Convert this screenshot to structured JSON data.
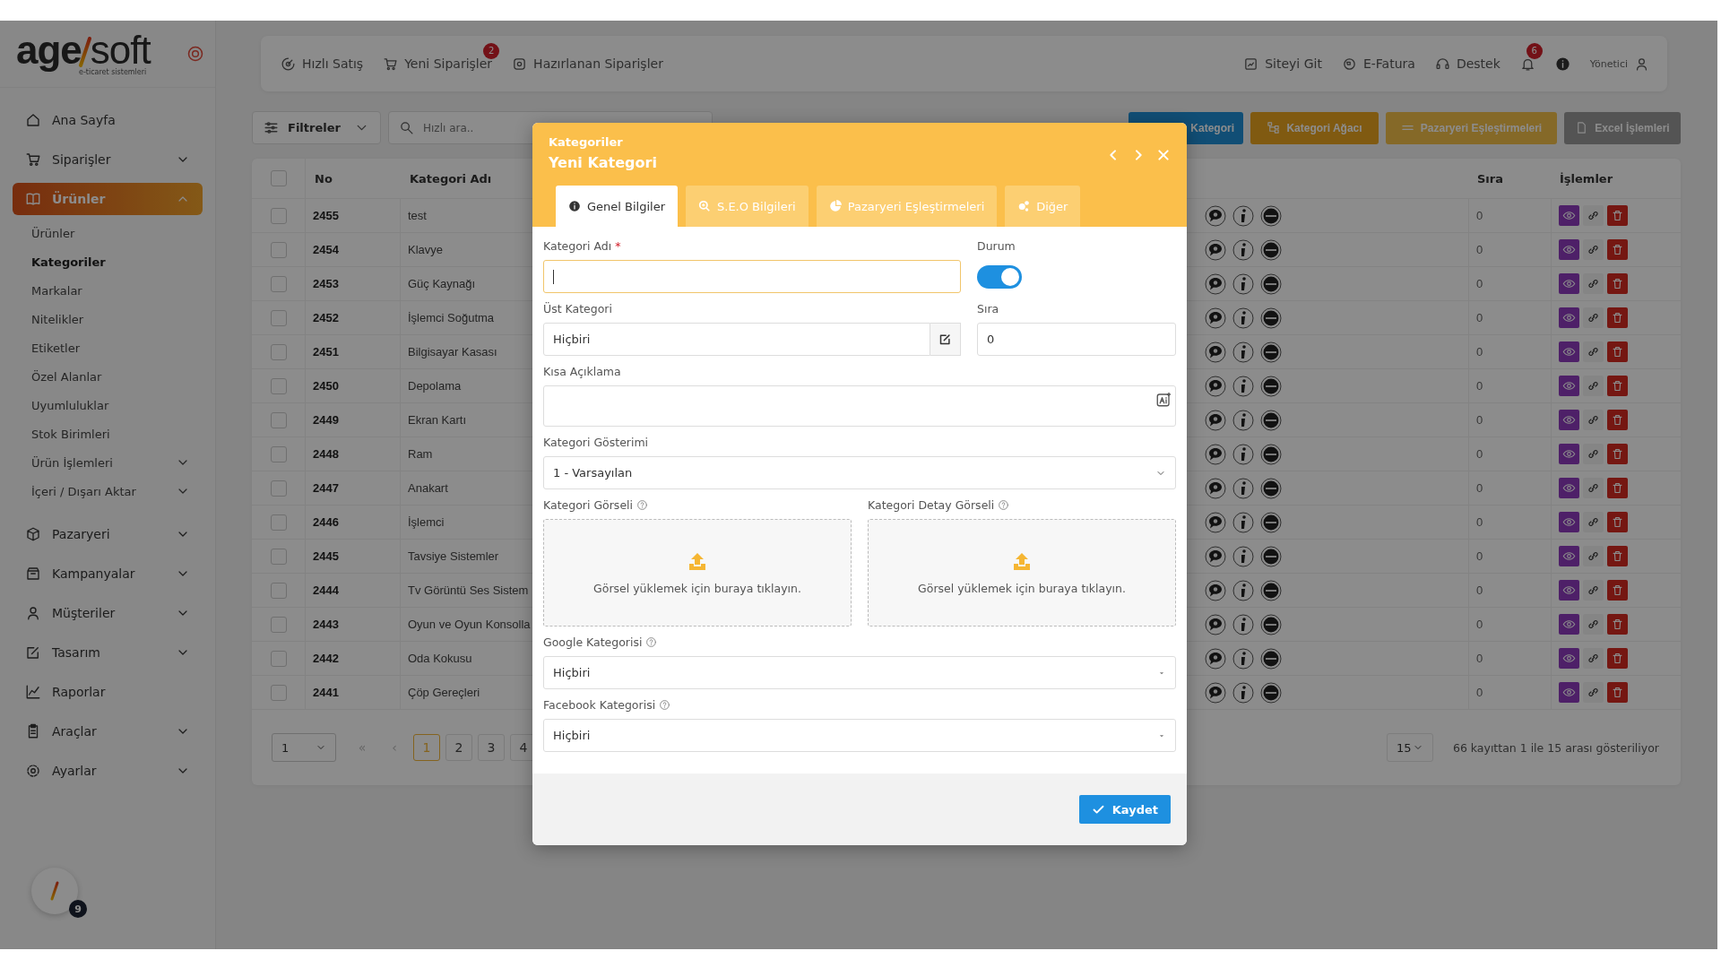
{
  "logo": {
    "bold": "age",
    "light": "soft",
    "tagline": "e-ticaret sistemleri"
  },
  "sidebar": {
    "items": [
      {
        "label": "Ana Sayfa",
        "expandable": false,
        "selected": false
      },
      {
        "label": "Siparişler",
        "expandable": true,
        "expanded": false,
        "selected": false
      },
      {
        "label": "Ürünler",
        "expandable": true,
        "expanded": true,
        "selected": true,
        "children": [
          {
            "label": "Ürünler",
            "selected": false,
            "expandable": false
          },
          {
            "label": "Kategoriler",
            "selected": true,
            "expandable": false
          },
          {
            "label": "Markalar",
            "selected": false,
            "expandable": false
          },
          {
            "label": "Nitelikler",
            "selected": false,
            "expandable": false
          },
          {
            "label": "Etiketler",
            "selected": false,
            "expandable": false
          },
          {
            "label": "Özel Alanlar",
            "selected": false,
            "expandable": false
          },
          {
            "label": "Uyumluluklar",
            "selected": false,
            "expandable": false
          },
          {
            "label": "Stok Birimleri",
            "selected": false,
            "expandable": false
          },
          {
            "label": "Ürün İşlemleri",
            "selected": false,
            "expandable": true
          },
          {
            "label": "İçeri / Dışarı Aktar",
            "selected": false,
            "expandable": true
          }
        ]
      },
      {
        "label": "Pazaryeri",
        "expandable": true,
        "expanded": false,
        "selected": false
      },
      {
        "label": "Kampanyalar",
        "expandable": true,
        "expanded": false,
        "selected": false
      },
      {
        "label": "Müşteriler",
        "expandable": true,
        "expanded": false,
        "selected": false
      },
      {
        "label": "Tasarım",
        "expandable": true,
        "expanded": false,
        "selected": false
      },
      {
        "label": "Raporlar",
        "expandable": false,
        "selected": false
      },
      {
        "label": "Araçlar",
        "expandable": true,
        "expanded": false,
        "selected": false
      },
      {
        "label": "Ayarlar",
        "expandable": true,
        "expanded": false,
        "selected": false
      }
    ]
  },
  "topbar": {
    "left": [
      {
        "label": "Hızlı Satış"
      },
      {
        "label": "Yeni Siparişler",
        "badge": "2"
      },
      {
        "label": "Hazırlanan Siparişler"
      }
    ],
    "right": [
      {
        "label": "Siteyi Git"
      },
      {
        "label": "E-Fatura"
      },
      {
        "label": "Destek"
      }
    ],
    "notifications_badge": "6",
    "user": "Yönetici"
  },
  "toolbar": {
    "filter": "Filtreler",
    "search_placeholder": "Hızlı ara..",
    "actions": [
      {
        "label": "Kategori",
        "kind": "primary"
      },
      {
        "label": "Kategori Ağacı",
        "kind": "warning"
      },
      {
        "label": "Pazaryeri Eşleştirmeleri",
        "kind": "accent"
      },
      {
        "label": "Excel İşlemleri",
        "kind": "muted"
      }
    ]
  },
  "table": {
    "columns": [
      "No",
      "Kategori Adı",
      "Sıra",
      "İşlemler"
    ],
    "header_checked": false,
    "rows": [
      {
        "no": "2455",
        "name": "test",
        "order": "0",
        "checked": false
      },
      {
        "no": "2454",
        "name": "Klavye",
        "order": "0",
        "checked": false
      },
      {
        "no": "2453",
        "name": "Güç Kaynağı",
        "order": "0",
        "checked": false
      },
      {
        "no": "2452",
        "name": "İşlemci Soğutma",
        "order": "0",
        "checked": false
      },
      {
        "no": "2451",
        "name": "Bilgisayar Kasası",
        "order": "0",
        "checked": false
      },
      {
        "no": "2450",
        "name": "Depolama",
        "order": "0",
        "checked": false
      },
      {
        "no": "2449",
        "name": "Ekran Kartı",
        "order": "0",
        "checked": false
      },
      {
        "no": "2448",
        "name": "Ram",
        "order": "0",
        "checked": false
      },
      {
        "no": "2447",
        "name": "Anakart",
        "order": "0",
        "checked": false
      },
      {
        "no": "2446",
        "name": "İşlemci",
        "order": "0",
        "checked": false
      },
      {
        "no": "2445",
        "name": "Tavsiye Sistemler",
        "order": "0",
        "checked": false
      },
      {
        "no": "2444",
        "name": "Tv Görüntü Ses Sistem",
        "order": "0",
        "checked": false
      },
      {
        "no": "2443",
        "name": "Oyun ve Oyun Konsolla",
        "order": "0",
        "checked": false
      },
      {
        "no": "2442",
        "name": "Oda Kokusu",
        "order": "0",
        "checked": false
      },
      {
        "no": "2441",
        "name": "Çöp Gereçleri",
        "order": "0",
        "checked": false
      }
    ]
  },
  "pagination": {
    "page_select": "1",
    "first": "«",
    "prev": "‹",
    "pages": [
      {
        "label": "1",
        "selected": true
      },
      {
        "label": "2",
        "selected": false
      },
      {
        "label": "3",
        "selected": false
      },
      {
        "label": "4",
        "selected": false
      }
    ],
    "per_page": "15",
    "summary": "66 kayıttan 1 ile 15 arası gösteriliyor"
  },
  "modal": {
    "breadcrumb": "Kategoriler",
    "title": "Yeni Kategori",
    "tabs": [
      {
        "label": "Genel Bilgiler",
        "selected": true
      },
      {
        "label": "S.E.O Bilgileri",
        "selected": false
      },
      {
        "label": "Pazaryeri Eşleştirmeleri",
        "selected": false
      },
      {
        "label": "Diğer",
        "selected": false
      }
    ],
    "name": {
      "label": "Kategori Adı",
      "required_mark": "*",
      "focused": true
    },
    "status": {
      "label": "Durum",
      "on": true
    },
    "parent": {
      "label": "Üst Kategori",
      "value": "Hiçbiri"
    },
    "order": {
      "label": "Sıra",
      "value": "0"
    },
    "summary": {
      "label": "Kısa Açıklama"
    },
    "display": {
      "label": "Kategori Gösterimi",
      "value": "1 - Varsayılan"
    },
    "uploads": [
      {
        "label": "Kategori Görseli",
        "hint": "Görsel yüklemek için buraya tıklayın."
      },
      {
        "label": "Kategori Detay Görseli",
        "hint": "Görsel yüklemek için buraya tıklayın."
      }
    ],
    "google": {
      "label": "Google Kategorisi",
      "value": "Hiçbiri"
    },
    "facebook": {
      "label": "Facebook Kategorisi",
      "value": "Hiçbiri"
    },
    "save": "Kaydet"
  },
  "widget": {
    "badge": "9"
  }
}
